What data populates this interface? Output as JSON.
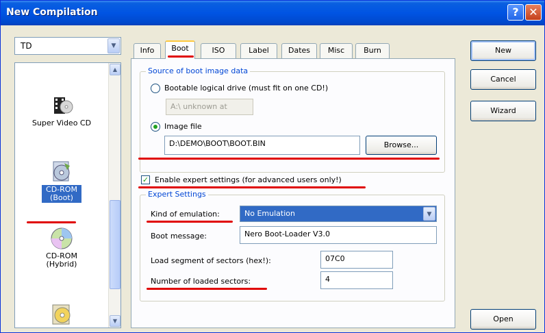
{
  "window": {
    "title": "New Compilation"
  },
  "titlebar": {
    "help_glyph": "?",
    "close_glyph": "✕"
  },
  "left": {
    "type_selected": "TD",
    "list_top_label": "",
    "items": [
      {
        "label": "Super Video CD",
        "icon": "super-video-cd-icon"
      },
      {
        "label": "CD-ROM (Boot)",
        "icon": "cdrom-boot-icon",
        "selected": true
      },
      {
        "label": "CD-ROM (Hybrid)",
        "icon": "cdrom-hybrid-icon"
      },
      {
        "label": "",
        "icon": "udf-disc-icon"
      }
    ]
  },
  "tabs": [
    "Info",
    "Boot",
    "ISO",
    "Label",
    "Dates",
    "Misc",
    "Burn"
  ],
  "active_tab": "Boot",
  "boot": {
    "source_group": "Source of boot image data",
    "radio_drive": "Bootable logical drive (must fit on one CD!)",
    "drive_select": "A:\\ unknown at",
    "radio_image": "Image file",
    "image_path": "D:\\DEMO\\BOOT\\BOOT.BIN",
    "browse": "Browse...",
    "enable_expert": "Enable expert settings (for advanced users only!)",
    "expert_group": "Expert Settings",
    "kind_label": "Kind of emulation:",
    "kind_value": "No Emulation",
    "msg_label": "Boot message:",
    "msg_value": "Nero Boot-Loader V3.0",
    "segment_label": "Load segment of sectors (hex!):",
    "segment_value": "07C0",
    "count_label": "Number of loaded sectors:",
    "count_value": "4"
  },
  "buttons": {
    "new": "New",
    "cancel": "Cancel",
    "wizard": "Wizard",
    "open": "Open"
  },
  "colors": {
    "annotation": "#e00000",
    "accent": "#316ac5",
    "title_bar": "#0054e3"
  }
}
